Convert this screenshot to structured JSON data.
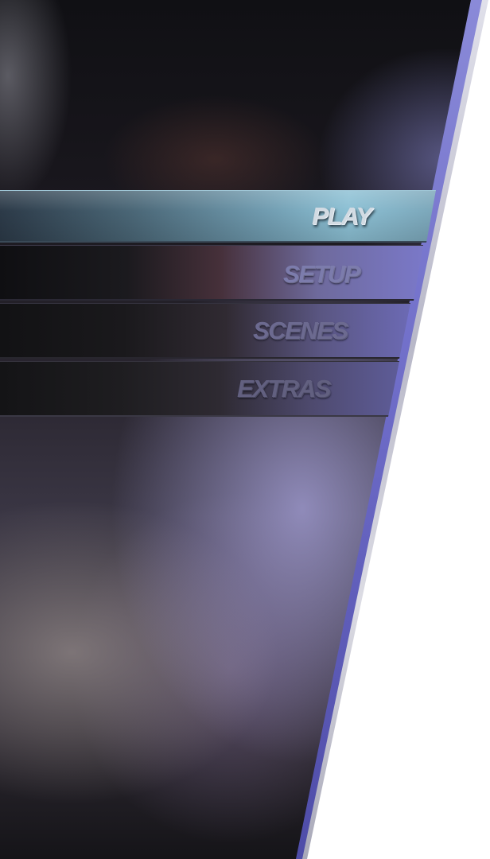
{
  "menu": {
    "items": [
      {
        "id": "play",
        "label": "PLAY",
        "selected": true
      },
      {
        "id": "setup",
        "label": "SETUP",
        "selected": false
      },
      {
        "id": "scenes",
        "label": "SCENES",
        "selected": false
      },
      {
        "id": "extras",
        "label": "EXTRAS",
        "selected": false
      }
    ]
  },
  "colors": {
    "selected_highlight": "#8cc0d4",
    "panel_accent": "#7a78c8",
    "edge_silver": "#dcdce4",
    "background": "#ffffff"
  }
}
